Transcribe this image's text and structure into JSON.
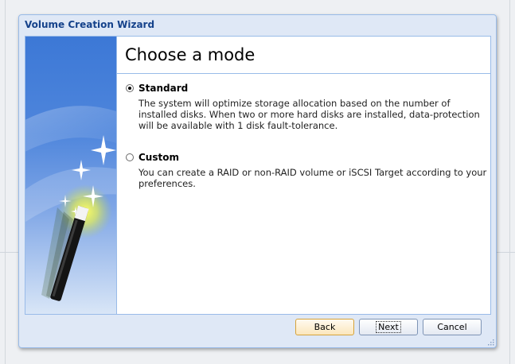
{
  "window": {
    "title": "Volume Creation Wizard"
  },
  "page": {
    "heading": "Choose a mode"
  },
  "options": [
    {
      "label": "Standard",
      "selected": true,
      "description": "The system will optimize storage allocation based on the number of installed disks. When two or more hard disks are installed, data-protection will be available with 1 disk fault-tolerance."
    },
    {
      "label": "Custom",
      "selected": false,
      "description": "You can create a RAID or non-RAID volume or iSCSI Target according to your preferences."
    }
  ],
  "buttons": {
    "back": "Back",
    "next": "Next",
    "cancel": "Cancel"
  },
  "colors": {
    "title_text": "#15428b",
    "border": "#99bbe8",
    "frame_bg": "#dfe8f6"
  },
  "icons": {
    "side_image": "magic-wand-icon",
    "resize_grip": "resize-grip-icon"
  }
}
